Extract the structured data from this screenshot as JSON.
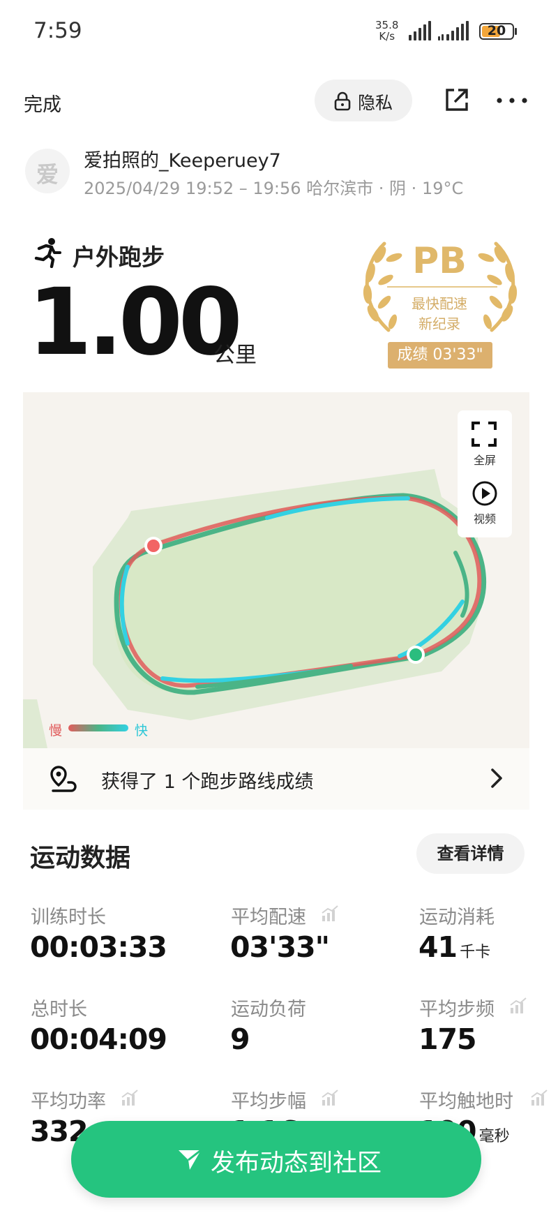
{
  "status_bar": {
    "time": "7:59",
    "net_speed_value": "35.8",
    "net_speed_unit": "K/s",
    "battery": "20"
  },
  "header": {
    "done_label": "完成",
    "privacy_label": "隐私"
  },
  "profile": {
    "avatar_char": "爱",
    "username": "爱拍照的_Keeperuey7",
    "meta": "2025/04/29 19:52 – 19:56 哈尔滨市 · 阴 · 19°C"
  },
  "activity": {
    "type": "户外跑步",
    "distance": "1.00",
    "unit": "公里"
  },
  "badge": {
    "title": "PB",
    "subtitle_line1": "最快配速",
    "subtitle_line2": "新纪录",
    "score": "成绩 03'33\"",
    "color": "#dcb06e"
  },
  "map": {
    "fullscreen_label": "全屏",
    "video_label": "视频",
    "legend_slow": "慢",
    "legend_fast": "快",
    "colors": {
      "slow": "#e25c5c",
      "mid": "#4bb487",
      "fast": "#33d1e2",
      "start_marker": "#f26464",
      "end_marker": "#2bbd7e"
    }
  },
  "route": {
    "text": "获得了 1 个跑步路线成绩"
  },
  "stats_section": {
    "title": "运动数据",
    "details_label": "查看详情",
    "items": [
      {
        "label": "训练时长",
        "value": "00:03:33",
        "unit": ""
      },
      {
        "label": "平均配速",
        "value": "03'33\"",
        "unit": ""
      },
      {
        "label": "运动消耗",
        "value": "41",
        "unit": "千卡"
      },
      {
        "label": "总时长",
        "value": "00:04:09",
        "unit": ""
      },
      {
        "label": "运动负荷",
        "value": "9",
        "unit": ""
      },
      {
        "label": "平均步频",
        "value": "175",
        "unit": ""
      },
      {
        "label": "平均功率",
        "value": "332",
        "unit": ""
      },
      {
        "label": "平均步幅",
        "value": "1.16",
        "unit": ""
      },
      {
        "label": "平均触地时",
        "value": "190",
        "unit": "毫秒"
      }
    ]
  },
  "publish": {
    "label": "发布动态到社区",
    "color": "#25c47f"
  }
}
